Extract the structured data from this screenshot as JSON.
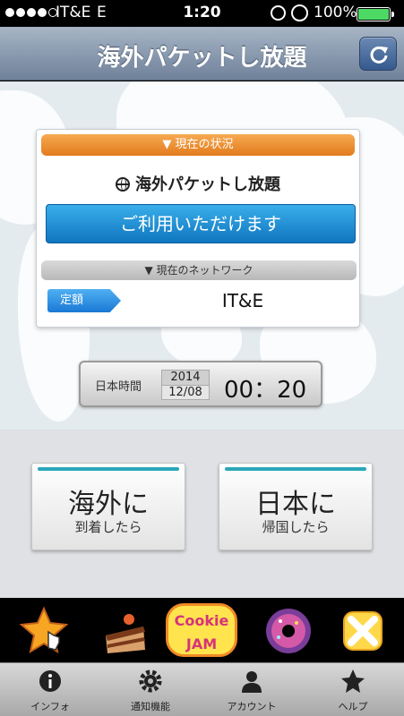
{
  "status_bar": {
    "carrier": "IT&E",
    "network_type": "E",
    "time": "1:20",
    "battery": "100%"
  },
  "nav": {
    "title": "海外パケットし放題",
    "refresh_icon": "refresh-icon"
  },
  "status_card": {
    "header": "▼ 現在の状況",
    "service_name": "海外パケットし放題",
    "availability": "ご利用いただけます",
    "network_header": "▼ 現在のネットワーク",
    "plan_badge": "定額",
    "carrier_name": "IT&E"
  },
  "clock": {
    "label": "日本時間",
    "year": "2014",
    "date": "12/08",
    "time": "00：20"
  },
  "actions": {
    "abroad": {
      "main": "海外に",
      "sub": "到着したら"
    },
    "home": {
      "main": "日本に",
      "sub": "帰国したら"
    }
  },
  "ad_banner": {
    "items": [
      "star-tap-icon",
      "cake-icon",
      "cookie-jam-logo",
      "donut-icon",
      "candy-icon"
    ],
    "cookie_jam_text": "Cookie JAM"
  },
  "tab_bar": {
    "tabs": [
      {
        "label": "インフォ",
        "icon": "info-icon"
      },
      {
        "label": "通知機能",
        "icon": "gear-icon"
      },
      {
        "label": "アカウント",
        "icon": "person-icon"
      },
      {
        "label": "ヘルプ",
        "icon": "star-icon"
      }
    ]
  },
  "colors": {
    "nav_top": "#a7b5c6",
    "nav_bottom": "#6f819a",
    "orange_header": "#e27b1e",
    "blue_button": "#1a8ad6",
    "teal_bar": "#2aa7b8"
  }
}
